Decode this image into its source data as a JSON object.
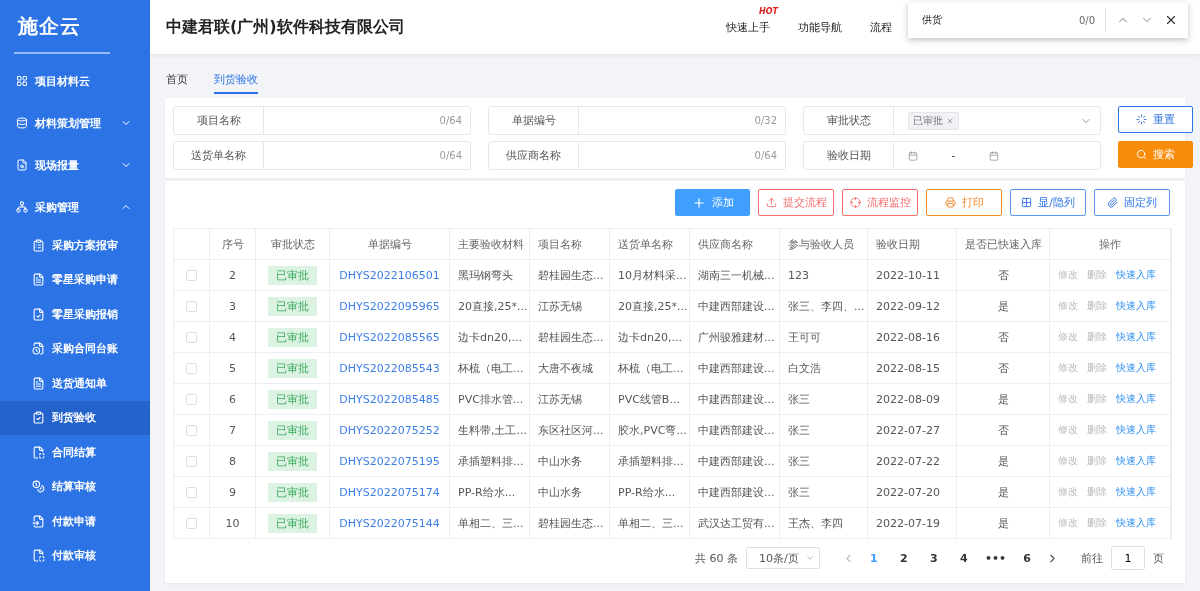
{
  "sidebar": {
    "logo": "施企云",
    "items": [
      {
        "label": "项目材料云",
        "has_children": false,
        "selected": false
      },
      {
        "label": "材料策划管理",
        "expanded": false,
        "has_children": true,
        "selected": false
      },
      {
        "label": "现场报量",
        "expanded": false,
        "has_children": true,
        "selected": false
      },
      {
        "label": "采购管理",
        "expanded": true,
        "has_children": true,
        "selected": false,
        "children": [
          {
            "label": "采购方案报审",
            "selected": false
          },
          {
            "label": "零星采购申请",
            "selected": false
          },
          {
            "label": "零星采购报销",
            "selected": false
          },
          {
            "label": "采购合同台账",
            "selected": false
          },
          {
            "label": "送货通知单",
            "selected": false
          },
          {
            "label": "到货验收",
            "selected": true
          },
          {
            "label": "合同结算",
            "selected": false
          },
          {
            "label": "结算审核",
            "selected": false
          },
          {
            "label": "付款申请",
            "selected": false
          },
          {
            "label": "付款审核",
            "selected": false
          }
        ]
      }
    ]
  },
  "header": {
    "title": "中建君联(广州)软件科技有限公司",
    "nav": [
      {
        "label": "快速上手",
        "badge": "HOT"
      },
      {
        "label": "功能导航"
      },
      {
        "label": "流程"
      }
    ]
  },
  "find_bar": {
    "query": "供货",
    "count": "0/0"
  },
  "tabs": [
    {
      "label": "首页",
      "selected": false
    },
    {
      "label": "到货验收",
      "selected": true
    }
  ],
  "filters": [
    {
      "kind": "text",
      "label": "项目名称",
      "counter": "0/64"
    },
    {
      "kind": "text",
      "label": "单据编号",
      "counter": "0/32"
    },
    {
      "kind": "select",
      "label": "审批状态",
      "tag": "已审批"
    },
    {
      "kind": "text",
      "label": "送货单名称",
      "counter": "0/64"
    },
    {
      "kind": "text",
      "label": "供应商名称",
      "counter": "0/64"
    },
    {
      "kind": "date",
      "label": "验收日期",
      "separator": "-"
    }
  ],
  "filter_buttons": [
    {
      "label": "重置"
    },
    {
      "label": "搜索"
    }
  ],
  "toolbar": [
    {
      "label": "添加"
    },
    {
      "label": "提交流程"
    },
    {
      "label": "流程监控"
    },
    {
      "label": "打印"
    },
    {
      "label": "显/隐列"
    },
    {
      "label": "固定列"
    }
  ],
  "table": {
    "columns": [
      "序号",
      "审批状态",
      "单据编号",
      "主要验收材料",
      "项目名称",
      "送货单名称",
      "供应商名称",
      "参与验收人员",
      "验收日期",
      "是否已快速入库",
      "操作"
    ],
    "rows": [
      {
        "checked": false,
        "no": "2",
        "status": "已审批",
        "code": "DHYS2022106501",
        "material": "黑玛钢弯头",
        "project": "碧桂园生态...",
        "delivery": "10月材料采...",
        "supplier": "湖南三一机械...",
        "people": "123",
        "date": "2022-10-11",
        "stored": "否",
        "actions": [
          "修改",
          "删除",
          "快速入库"
        ]
      },
      {
        "checked": false,
        "no": "3",
        "status": "已审批",
        "code": "DHYS2022095965",
        "material": "20直接,25*...",
        "project": "江苏无锡",
        "delivery": "20直接,25*...",
        "supplier": "中建西部建设...",
        "people": "张三、李四、...",
        "date": "2022-09-12",
        "stored": "是",
        "actions": [
          "修改",
          "删除",
          "快速入库"
        ]
      },
      {
        "checked": false,
        "no": "4",
        "status": "已审批",
        "code": "DHYS2022085565",
        "material": "边卡dn20,...",
        "project": "碧桂园生态...",
        "delivery": "边卡dn20,...",
        "supplier": "广州骏雅建材...",
        "people": "王可可",
        "date": "2022-08-16",
        "stored": "否",
        "actions": [
          "修改",
          "删除",
          "快速入库"
        ]
      },
      {
        "checked": false,
        "no": "5",
        "status": "已审批",
        "code": "DHYS2022085543",
        "material": "杯梳（电工...",
        "project": "大唐不夜城",
        "delivery": "杯梳（电工...",
        "supplier": "中建西部建设...",
        "people": "白文浩",
        "date": "2022-08-15",
        "stored": "否",
        "actions": [
          "修改",
          "删除",
          "快速入库"
        ]
      },
      {
        "checked": false,
        "no": "6",
        "status": "已审批",
        "code": "DHYS2022085485",
        "material": "PVC排水管...",
        "project": "江苏无锡",
        "delivery": "PVC线管B...",
        "supplier": "中建西部建设...",
        "people": "张三",
        "date": "2022-08-09",
        "stored": "是",
        "actions": [
          "修改",
          "删除",
          "快速入库"
        ]
      },
      {
        "checked": false,
        "no": "7",
        "status": "已审批",
        "code": "DHYS2022075252",
        "material": "生料带,土工...",
        "project": "东区社区河...",
        "delivery": "胶水,PVC弯...",
        "supplier": "中建西部建设...",
        "people": "张三",
        "date": "2022-07-27",
        "stored": "否",
        "actions": [
          "修改",
          "删除",
          "快速入库"
        ]
      },
      {
        "checked": false,
        "no": "8",
        "status": "已审批",
        "code": "DHYS2022075195",
        "material": "承插塑料排...",
        "project": "中山水务",
        "delivery": "承插塑料排...",
        "supplier": "中建西部建设...",
        "people": "张三",
        "date": "2022-07-22",
        "stored": "是",
        "actions": [
          "修改",
          "删除",
          "快速入库"
        ]
      },
      {
        "checked": false,
        "no": "9",
        "status": "已审批",
        "code": "DHYS2022075174",
        "material": "PP-R给水...",
        "project": "中山水务",
        "delivery": "PP-R给水...",
        "supplier": "中建西部建设...",
        "people": "张三",
        "date": "2022-07-20",
        "stored": "是",
        "actions": [
          "修改",
          "删除",
          "快速入库"
        ]
      },
      {
        "checked": false,
        "no": "10",
        "status": "已审批",
        "code": "DHYS2022075144",
        "material": "单相二、三...",
        "project": "碧桂园生态...",
        "delivery": "单相二、三...",
        "supplier": "武汉达工贸有...",
        "people": "王杰、李四",
        "date": "2022-07-19",
        "stored": "是",
        "actions": [
          "修改",
          "删除",
          "快速入库"
        ]
      }
    ]
  },
  "pagination": {
    "total": "共 60 条",
    "page_size": "10条/页",
    "pages": [
      {
        "label": "1",
        "selected": true
      },
      {
        "label": "2",
        "selected": false
      },
      {
        "label": "3",
        "selected": false
      },
      {
        "label": "4",
        "selected": false
      },
      {
        "label": "•••",
        "selected": false
      },
      {
        "label": "6",
        "selected": false
      }
    ],
    "jump_label": "前往",
    "jump_value": "1",
    "jump_suffix": "页"
  }
}
